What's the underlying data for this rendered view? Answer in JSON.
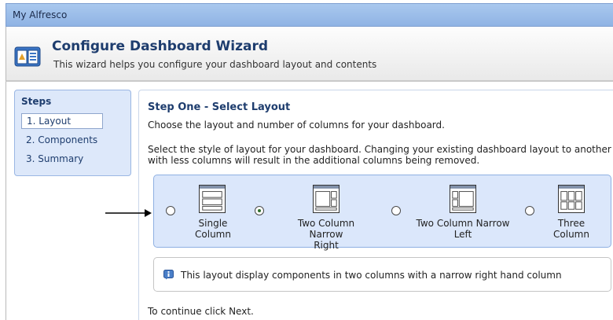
{
  "app": {
    "title": "My Alfresco"
  },
  "wizard": {
    "title": "Configure Dashboard Wizard",
    "subtitle": "This wizard helps you configure your dashboard layout and contents"
  },
  "steps": {
    "title": "Steps",
    "items": [
      {
        "label": "1. Layout",
        "active": true
      },
      {
        "label": "2. Components",
        "active": false
      },
      {
        "label": "3. Summary",
        "active": false
      }
    ]
  },
  "main": {
    "title": "Step One - Select Layout",
    "subtitle": "Choose the layout and number of columns for your dashboard.",
    "description": "Select the style of layout for your dashboard. Changing your existing dashboard layout to another with less columns will result in the additional columns being removed.",
    "layouts": [
      {
        "label_line1": "Single",
        "label_line2": "Column",
        "selected": false
      },
      {
        "label_line1": "Two Column Narrow",
        "label_line2": "Right",
        "selected": true
      },
      {
        "label_line1": "Two Column Narrow",
        "label_line2": "Left",
        "selected": false
      },
      {
        "label_line1": "Three",
        "label_line2": "Column",
        "selected": false
      }
    ],
    "info_text": "This layout display components in two columns with a narrow right hand column",
    "continue_text": "To continue click Next."
  },
  "colors": {
    "accent": "#1e3d6e",
    "panel_bg": "#dbe7fb",
    "titlebar": "#a9c8ee"
  },
  "icons": {
    "wizard": "dashboard-wizard-icon",
    "info": "info-icon",
    "arrow": "pointer-arrow-icon"
  }
}
